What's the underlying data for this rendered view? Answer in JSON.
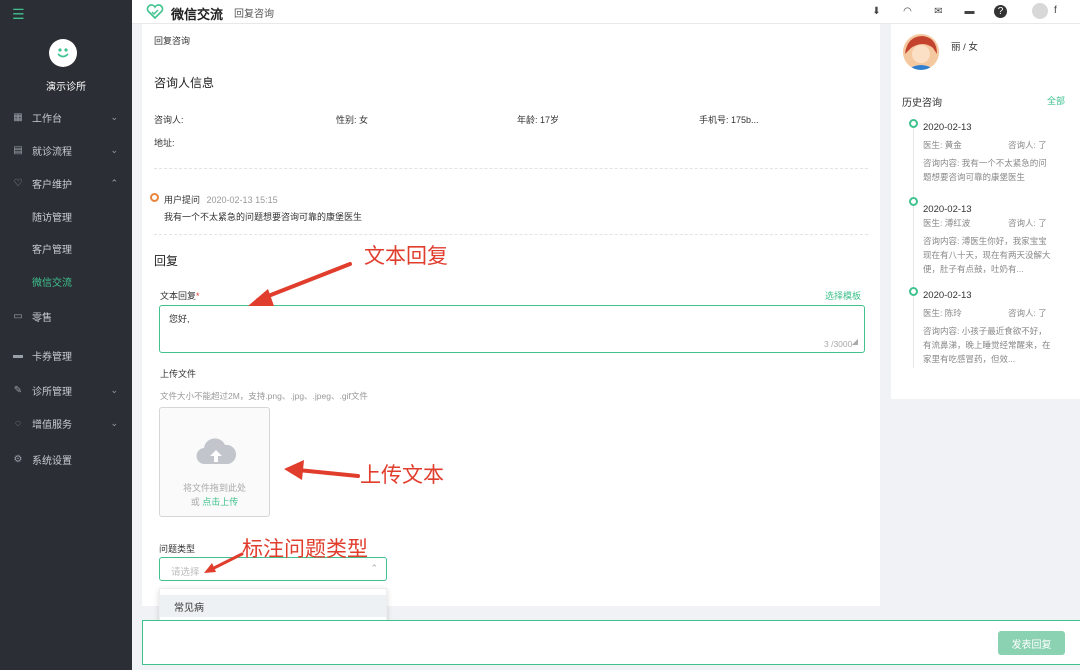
{
  "sidebar": {
    "clinic_name": "演示诊所",
    "items": [
      {
        "label": "工作台",
        "icon": "grid-icon",
        "chev": "⌄"
      },
      {
        "label": "就诊流程",
        "icon": "clipboard-icon",
        "chev": "⌄"
      },
      {
        "label": "客户维护",
        "icon": "heart-icon",
        "chev": "⌃"
      },
      {
        "label": "随访管理"
      },
      {
        "label": "客户管理"
      },
      {
        "label": "微信交流"
      },
      {
        "label": "零售",
        "icon": "retail-icon"
      },
      {
        "label": "卡券管理",
        "icon": "card-icon"
      },
      {
        "label": "诊所管理",
        "icon": "wrench-icon",
        "chev": "⌄"
      },
      {
        "label": "增值服务",
        "icon": "bulb-icon",
        "chev": "⌄"
      },
      {
        "label": "系统设置",
        "icon": "gear-icon"
      }
    ]
  },
  "header": {
    "title": "微信交流",
    "subtitle": "回复咨询",
    "user_initial": "f"
  },
  "main": {
    "breadcrumb": "回复咨询",
    "info_title": "咨询人信息",
    "fields": [
      {
        "label": "咨询人:",
        "value": ""
      },
      {
        "label": "性别:",
        "value": "女"
      },
      {
        "label": "年龄:",
        "value": "17岁"
      },
      {
        "label": "手机号:",
        "value": "175b..."
      },
      {
        "label": "地址:",
        "value": ""
      }
    ],
    "question": {
      "tag": "用户提问",
      "time": "2020-02-13 15:15",
      "text": "我有一个不太紧急的问题想要咨询可靠的康堡医生"
    },
    "reply_title": "回复",
    "text_reply": {
      "label": "文本回复",
      "required_mark": "*",
      "template_link": "选择模板",
      "value": "您好,",
      "counter": "3 /3000"
    },
    "upload": {
      "label": "上传文件",
      "hint": "文件大小不能超过2M，支持.png、.jpg、.jpeg、.gif文件",
      "drag_text": "将文件拖到此处",
      "or_text": "或",
      "click_text": "点击上传"
    },
    "question_type": {
      "label": "问题类型",
      "placeholder": "请选择",
      "option": "常见病"
    },
    "annotations": {
      "text_reply": "文本回复",
      "upload": "上传文本",
      "question_type": "标注问题类型"
    }
  },
  "right_panel": {
    "patient_label": "丽 / 女",
    "history_title": "历史咨询",
    "all_link": "全部",
    "history": [
      {
        "date": "2020-02-13",
        "doctor": "医生: 黄金",
        "consultant": "咨询人: 了",
        "content": "咨询内容: 我有一个不太紧急的问题想要咨询可靠的康堡医生"
      },
      {
        "date": "2020-02-13",
        "doctor": "医生: 溥红波",
        "consultant": "咨询人: 了",
        "content": "咨询内容: 溥医生你好，我家宝宝现在有八十天，现在有两天没解大便，肚子有点鼓，吐奶有..."
      },
      {
        "date": "2020-02-13",
        "doctor": "医生: 陈玲",
        "consultant": "咨询人: 了",
        "content": "咨询内容: 小孩子最近食欲不好，有流鼻涕，晚上睡觉经常醒来，在家里有吃感冒药，但效..."
      }
    ]
  },
  "footer": {
    "submit_label": "发表回复"
  },
  "colors": {
    "accent": "#3fc28e",
    "sidebar_bg": "#2b2f35",
    "annotation": "#e03d2d",
    "question_dot": "#e8843c"
  }
}
